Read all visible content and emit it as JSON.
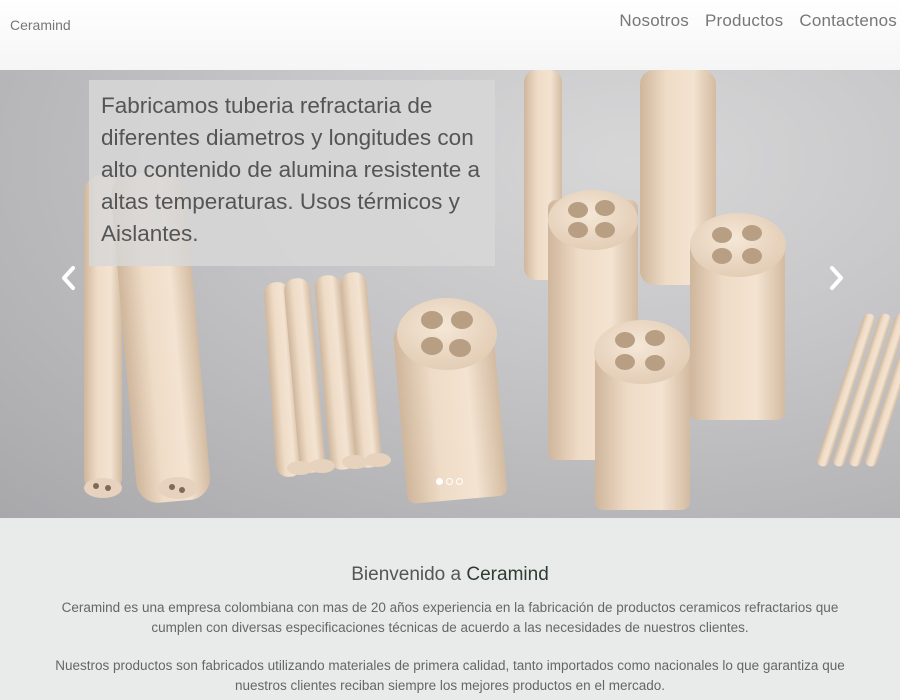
{
  "navbar": {
    "brand": "Ceramind",
    "links": [
      "Nosotros",
      "Productos",
      "Contactenos"
    ]
  },
  "carousel": {
    "caption": "Fabricamos tuberia refractaria de diferentes diametros y longitudes con alto contenido de alumina resistente a altas temperaturas. Usos térmicos y Aislantes.",
    "slide_count": 3,
    "active_slide": 1,
    "image_subject": "ceramic refractory tubes and cylinders"
  },
  "welcome": {
    "title_prefix": "Bienvenido a",
    "title_brand": "Ceramind",
    "paragraph1": "Ceramind es una empresa colombiana con mas de 20 años experiencia en la fabricación de productos ceramicos refractarios que cumplen con diversas especificaciones técnicas de acuerdo a las necesidades de nuestros clientes.",
    "paragraph2": "Nuestros productos son fabricados utilizando materiales de primera calidad, tanto importados como nacionales lo que garantiza que nuestros clientes reciban siempre los mejores productos en el mercado."
  },
  "colors": {
    "ceramic": "#ecd9c4",
    "background_gray": "#c6c6c8",
    "section_bg": "#e9ebea",
    "brand_dark": "#2e3c32"
  },
  "icons": {
    "prev": "chevron-left-icon",
    "next": "chevron-right-icon"
  }
}
